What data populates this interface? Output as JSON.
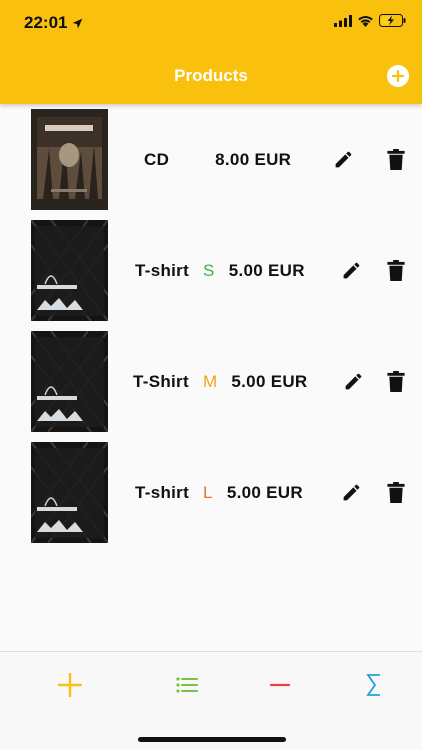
{
  "status_bar": {
    "time": "22:01"
  },
  "header": {
    "title": "Products"
  },
  "products": [
    {
      "name": "CD",
      "size": "",
      "price": "8.00 EUR"
    },
    {
      "name": "T-shirt",
      "size": "S",
      "price": "5.00 EUR",
      "size_color": "#3fae49"
    },
    {
      "name": "T-Shirt",
      "size": "M",
      "price": "5.00 EUR",
      "size_color": "#f2a21b"
    },
    {
      "name": "T-shirt",
      "size": "L",
      "price": "5.00 EUR",
      "size_color": "#e8703a"
    }
  ],
  "colors": {
    "header": "#f9c00e",
    "tab_add": "#f9c00e",
    "tab_list": "#7cc242",
    "tab_remove": "#e8453c",
    "tab_sum": "#1fa2d8"
  },
  "icons": {
    "header_action": "plus-circle-icon",
    "row_edit": "pencil-icon",
    "row_delete": "trash-icon",
    "tabs": [
      "plus-icon",
      "list-icon",
      "minus-icon",
      "sigma-icon"
    ]
  }
}
